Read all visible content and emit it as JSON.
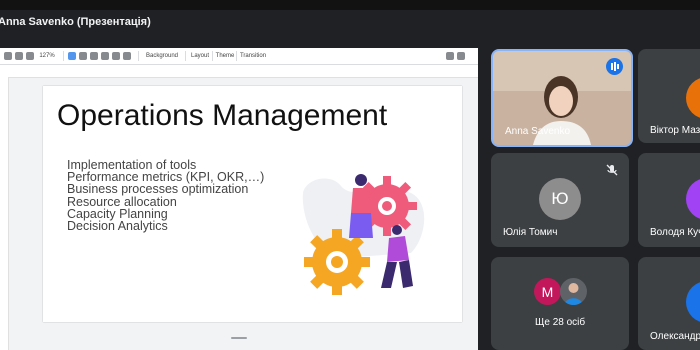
{
  "window": {
    "title": "Anna Savenko (Презентація)"
  },
  "editor": {
    "zoom": "127%",
    "menu": {
      "background": "Background",
      "layout": "Layout",
      "theme": "Theme",
      "transition": "Transition"
    }
  },
  "slide": {
    "title": "Operations Management",
    "bullets": [
      "Implementation of tools",
      "Performance metrics (KPI, OKR,…)",
      "Business processes optimization",
      "Resource allocation",
      "Capacity Planning",
      "Decision Analytics"
    ]
  },
  "participants": [
    {
      "name": "Anna Savenko",
      "speaking": true
    },
    {
      "name": "Віктор Маз",
      "avatar_color": "#e8710a"
    },
    {
      "name": "Юлія Томич",
      "initial": "Ю",
      "avatar_color": "#8d8d8d",
      "muted": true
    },
    {
      "name": "Володя Куч",
      "avatar_color": "#a142f4"
    },
    {
      "name": "Ще 28 осіб",
      "initial": "M",
      "avatar_color": "#c2185b"
    },
    {
      "name": "Олександр",
      "avatar_color": "#1a73e8"
    }
  ],
  "icons": [
    "speaking-indicator-icon",
    "mic-off-icon",
    "gear-icon",
    "cursor-icon"
  ]
}
